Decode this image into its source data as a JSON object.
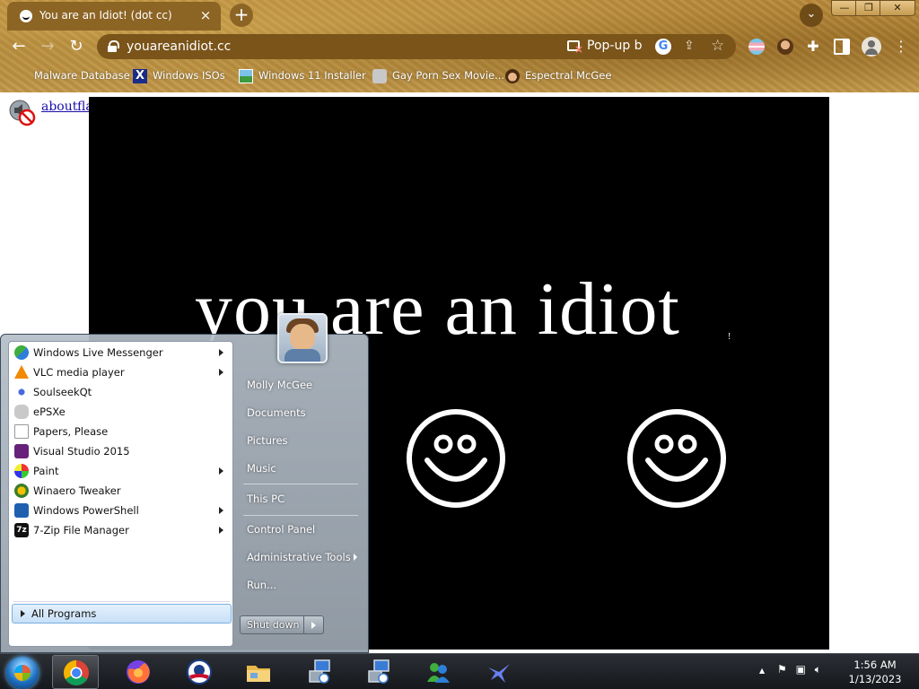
{
  "browser": {
    "tab_title": "You are an Idiot! (dot cc)",
    "tab_close": "×",
    "new_tab": "+",
    "url": "youareanidiot.cc",
    "popup_blocked": "Pop-up bl",
    "google_badge": "G",
    "menu": "⋮",
    "bookmarks": [
      {
        "label": "Malware Database"
      },
      {
        "label": "Windows ISOs"
      },
      {
        "label": "Windows 11 Installer"
      },
      {
        "label": "Gay Porn Sex Movie..."
      },
      {
        "label": "Espectral McGee"
      }
    ],
    "window_controls": {
      "minimize": "—",
      "maximize": "❐",
      "close": "✕"
    }
  },
  "page": {
    "links": [
      {
        "label": "about"
      },
      {
        "label": "flash"
      }
    ],
    "headline": "you are an idiot",
    "headline_mark": "!"
  },
  "start_menu": {
    "programs": [
      {
        "label": "Windows Live Messenger",
        "submenu": true
      },
      {
        "label": "VLC media player",
        "submenu": true
      },
      {
        "label": "SoulseekQt",
        "submenu": false
      },
      {
        "label": "ePSXe",
        "submenu": false
      },
      {
        "label": "Papers, Please",
        "submenu": false
      },
      {
        "label": "Visual Studio 2015",
        "submenu": false
      },
      {
        "label": "Paint",
        "submenu": true
      },
      {
        "label": "Winaero Tweaker",
        "submenu": false
      },
      {
        "label": "Windows PowerShell",
        "submenu": true
      },
      {
        "label": "7-Zip File Manager",
        "submenu": true
      }
    ],
    "all_programs": "All Programs",
    "right_items": [
      {
        "label": "Molly McGee"
      },
      {
        "label": "Documents"
      },
      {
        "label": "Pictures"
      },
      {
        "label": "Music"
      },
      {
        "label": "This PC"
      },
      {
        "label": "Control Panel"
      },
      {
        "label": "Administrative Tools",
        "submenu": true
      },
      {
        "label": "Run..."
      }
    ],
    "shutdown": "Shut down"
  },
  "taskbar": {
    "time": "1:56 AM",
    "date": "1/13/2023",
    "tray_chevron": "▲"
  }
}
